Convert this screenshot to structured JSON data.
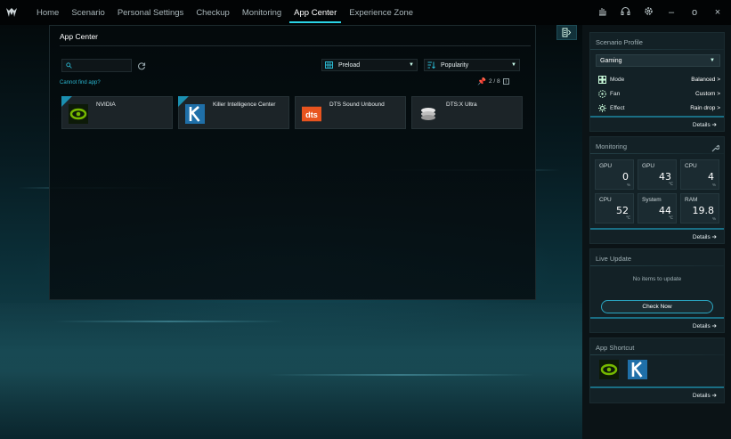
{
  "nav": {
    "items": [
      "Home",
      "Scenario",
      "Personal Settings",
      "Checkup",
      "Monitoring",
      "App Center",
      "Experience Zone"
    ],
    "active": "App Center"
  },
  "window_controls": [
    "⛶",
    "◎",
    "⚙",
    "–",
    "o",
    "×"
  ],
  "app_center": {
    "title": "App Center",
    "search_placeholder": "",
    "cannot_find": "Cannot find app?",
    "filter_label": "Preload",
    "sort_label": "Popularity",
    "pin_count": "2 / 8",
    "apps": [
      {
        "name": "NVIDIA",
        "icon": "nvidia-icon",
        "pinned": true
      },
      {
        "name": "Killer Intelligence Center",
        "icon": "killer-icon",
        "pinned": true
      },
      {
        "name": "DTS Sound Unbound",
        "icon": "dts-icon",
        "pinned": false
      },
      {
        "name": "DTS:X Ultra",
        "icon": "dtsx-icon",
        "pinned": false
      }
    ]
  },
  "scenario_profile": {
    "title": "Scenario Profile",
    "profile": "Gaming",
    "rows": [
      {
        "label": "Mode",
        "value": "Balanced >",
        "icon": "mode-icon"
      },
      {
        "label": "Fan",
        "value": "Custom >",
        "icon": "fan-icon"
      },
      {
        "label": "Effect",
        "value": "Rain drop >",
        "icon": "effect-icon"
      }
    ],
    "details": "Details ➔"
  },
  "monitoring": {
    "title": "Monitoring",
    "tiles": [
      {
        "label": "GPU",
        "value": "0",
        "unit": "%"
      },
      {
        "label": "GPU",
        "value": "43",
        "unit": "℃"
      },
      {
        "label": "CPU",
        "value": "4",
        "unit": "%"
      },
      {
        "label": "CPU",
        "value": "52",
        "unit": "℃"
      },
      {
        "label": "System",
        "value": "44",
        "unit": "℃"
      },
      {
        "label": "RAM",
        "value": "19.8",
        "unit": "%"
      }
    ],
    "details": "Details ➔"
  },
  "live_update": {
    "title": "Live Update",
    "empty_text": "No items to update",
    "button": "Check Now",
    "details": "Details ➔"
  },
  "app_shortcut": {
    "title": "App Shortcut",
    "items": [
      "nvidia-icon",
      "killer-icon"
    ],
    "details": "Details ➔"
  },
  "colors": {
    "accent": "#2ad4e6",
    "nvidia_green": "#76b900",
    "dts_orange": "#e8541f"
  }
}
